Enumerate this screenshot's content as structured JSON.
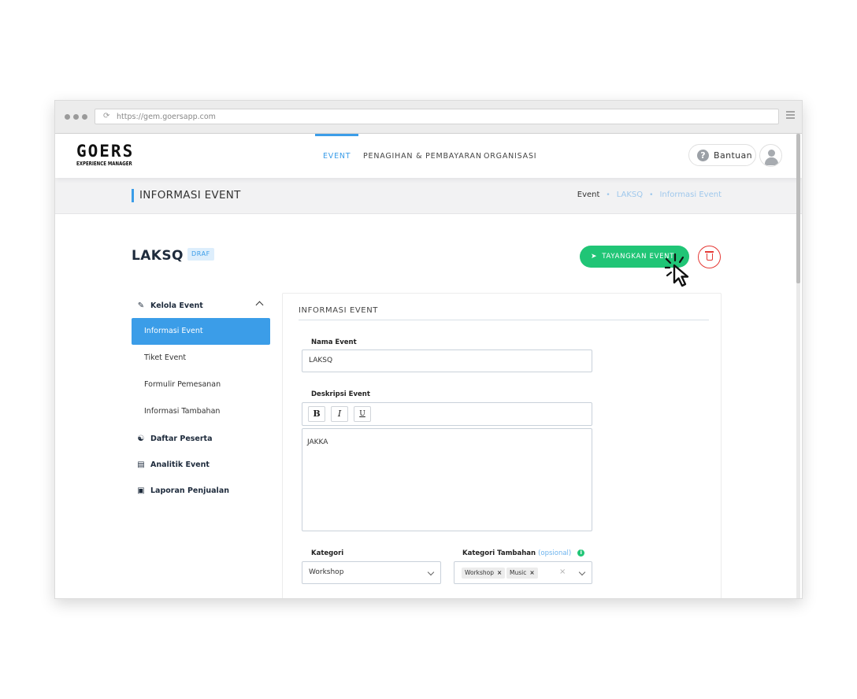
{
  "browser": {
    "url": "https://gem.goersapp.com"
  },
  "brand": {
    "name": "GOERS",
    "tagline": "EXPERIENCE MANAGER"
  },
  "nav": {
    "tabs": [
      {
        "label": "EVENT",
        "active": true
      },
      {
        "label": "PENAGIHAN & PEMBAYARAN",
        "active": false
      },
      {
        "label": "ORGANISASI",
        "active": false
      }
    ],
    "help_label": "Bantuan",
    "help_icon": "?"
  },
  "page": {
    "title": "INFORMASI EVENT",
    "breadcrumb": [
      "Event",
      "LAKSQ",
      "Informasi Event"
    ]
  },
  "event": {
    "name": "LAKSQ",
    "status": "DRAF",
    "publish_label": "TAYANGKAN EVENT"
  },
  "sidebar": {
    "groups": [
      {
        "label": "Kelola Event",
        "icon": "edit-icon",
        "expanded": true,
        "items": [
          {
            "label": "Informasi Event",
            "active": true
          },
          {
            "label": "Tiket Event",
            "active": false
          },
          {
            "label": "Formulir Pemesanan",
            "active": false
          },
          {
            "label": "Informasi Tambahan",
            "active": false
          }
        ]
      },
      {
        "label": "Daftar Peserta",
        "icon": "users-icon"
      },
      {
        "label": "Analitik Event",
        "icon": "bar-chart-icon"
      },
      {
        "label": "Laporan Penjualan",
        "icon": "money-icon"
      }
    ]
  },
  "form": {
    "section_title": "INFORMASI EVENT",
    "name_label": "Nama Event",
    "name_value": "LAKSQ",
    "desc_label": "Deskripsi Event",
    "toolbar": {
      "bold": "B",
      "italic": "I",
      "underline": "U"
    },
    "desc_value": "JAKKA",
    "category_label": "Kategori",
    "category_value": "Workshop",
    "extra_label": "Kategori Tambahan",
    "extra_optional": "(opsional)",
    "extra_info": "i",
    "extra_tags": [
      "Workshop",
      "Music"
    ],
    "tag_remove": "×",
    "clear_symbol": "×"
  },
  "colors": {
    "accent": "#3b9de8",
    "success": "#20c576",
    "danger": "#e53935",
    "draft_badge_bg": "#ddeefc"
  }
}
